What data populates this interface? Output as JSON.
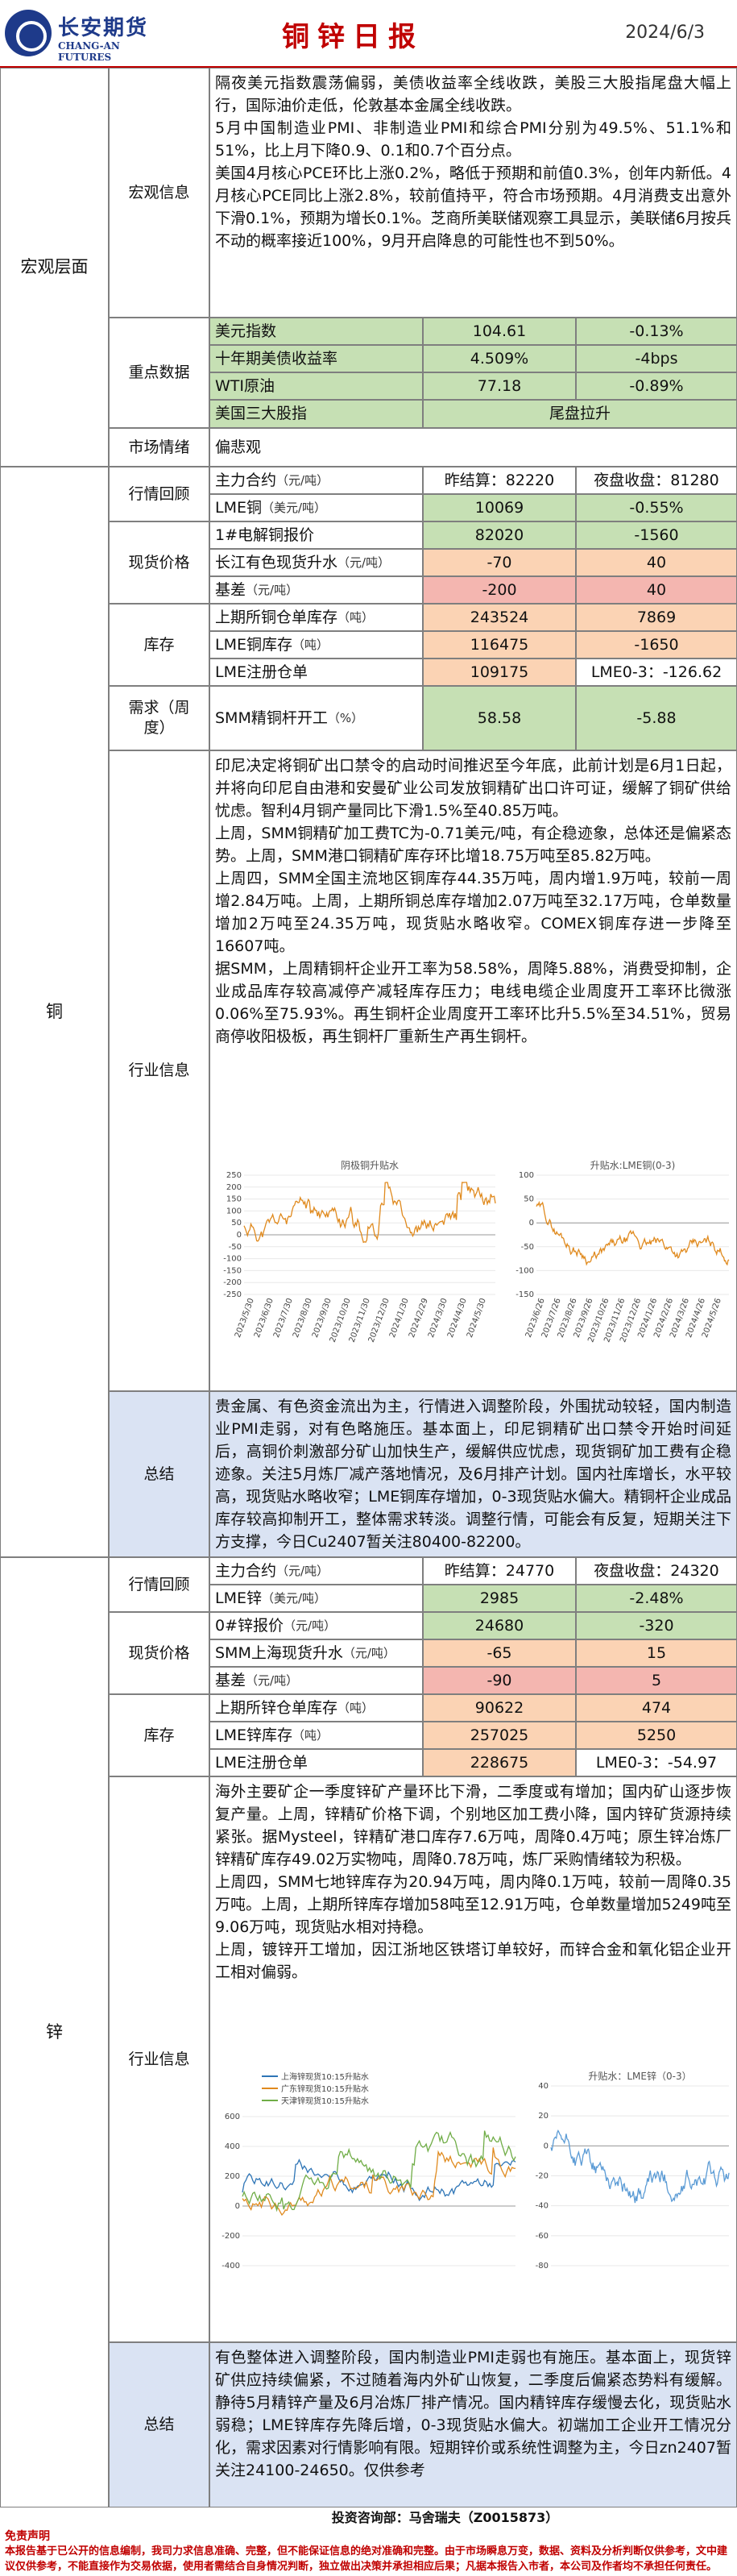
{
  "header": {
    "logo_cn": "长安期货",
    "logo_en": "CHANG-AN FUTURES",
    "title": "铜锌日报",
    "date": "2024/6/3"
  },
  "macro": {
    "section": "宏观层面",
    "info_label": "宏观信息",
    "info_text": "隔夜美元指数震荡偏弱，美债收益率全线收跌，美股三大股指尾盘大幅上行，国际油价走低，伦敦基本金属全线收跌。\n5月中国制造业PMI、非制造业PMI和综合PMI分别为49.5%、51.1%和51%，比上月下降0.9、0.1和0.7个百分点。\n美国4月核心PCE环比上涨0.2%，略低于预期和前值0.3%，创年内新低。4月核心PCE同比上涨2.8%，较前值持平，符合市场预期。4月消费支出意外下滑0.1%，预期为增长0.1%。芝商所美联储观察工具显示，美联储6月按兵不动的概率接近100%，9月开启降息的可能性也不到50%。",
    "key_label": "重点数据",
    "key_rows": [
      {
        "name": "美元指数",
        "value": "104.61",
        "change": "-0.13%"
      },
      {
        "name": "十年期美债收益率",
        "value": "4.509%",
        "change": "-4bps"
      },
      {
        "name": "WTI原油",
        "value": "77.18",
        "change": "-0.89%"
      },
      {
        "name": "美国三大股指",
        "value": "",
        "change": "尾盘拉升"
      }
    ],
    "sentiment_label": "市场情绪",
    "sentiment_value": "偏悲观"
  },
  "copper": {
    "section": "铜",
    "review_label": "行情回顾",
    "main_contract": "主力合约",
    "unit_yuan_ton": "（元/吨）",
    "unit_usd_ton": "（美元/吨）",
    "unit_ton": "（吨）",
    "unit_pct": "（%）",
    "settle": "昨结算：82220",
    "night": "夜盘收盘：81280",
    "lme_name": "LME铜",
    "lme_value": "10069",
    "lme_change": "-0.55%",
    "spot_label": "现货价格",
    "spot_rows": [
      {
        "name": "1#电解铜报价",
        "unit": "",
        "value": "82020",
        "change": "-1560"
      },
      {
        "name": "长江有色现货升水",
        "unit": "（元/吨）",
        "value": "-70",
        "change": "40"
      },
      {
        "name": "基差",
        "unit": "（元/吨）",
        "value": "-200",
        "change": "40"
      }
    ],
    "inv_label": "库存",
    "inv_rows": [
      {
        "name": "上期所铜仓单库存",
        "unit": "（吨）",
        "value": "243524",
        "change": "7869"
      },
      {
        "name": "LME铜库存",
        "unit": "（吨）",
        "value": "116475",
        "change": "-1650"
      },
      {
        "name": "LME注册仓单",
        "unit": "",
        "value": "109175",
        "change": "LME0-3：-126.62"
      }
    ],
    "demand_label": "需求（周度）",
    "demand_name": "SMM精铜杆开工",
    "demand_value": "58.58",
    "demand_change": "-5.88",
    "industry_label": "行业信息",
    "industry_text": "印尼决定将铜矿出口禁令的启动时间推迟至今年底，此前计划是6月1日起，并将向印尼自由港和安曼矿业公司发放铜精矿出口许可证，缓解了铜矿供给忧虑。智利4月铜产量同比下滑1.5%至40.85万吨。\n上周，SMM铜精矿加工费TC为-0.71美元/吨，有企稳迹象，总体还是偏紧态势。上周，SMM港口铜精矿库存环比增18.75万吨至85.82万吨。\n上周四，SMM全国主流地区铜库存44.35万吨，周内增1.9万吨，较前一周增2.84万吨。上周，上期所铜总库存增加2.07万吨至32.17万吨，仓单数量增加2万吨至24.35万吨，现货贴水略收窄。COMEX铜库存进一步降至16607吨。\n据SMM，上周精铜杆企业开工率为58.58%，周降5.88%，消费受抑制，企业成品库存较高减停产减轻库存压力；电线电缆企业周度开工率环比微涨0.06%至75.93%。再生铜杆企业周度开工率环比升5.5%至34.51%，贸易商停收阳极板，再生铜杆厂重新生产再生铜杆。",
    "summary_label": "总结",
    "summary_text": "贵金属、有色资金流出为主，行情进入调整阶段，外围扰动较轻，国内制造业PMI走弱，对有色略施压。基本面上，印尼铜精矿出口禁令开始时间延后，高铜价刺激部分矿山加快生产，缓解供应忧虑，现货铜矿加工费有企稳迹象。关注5月炼厂减产落地情况，及6月排产计划。国内社库增长，水平较高，现货贴水略收窄；LME铜库存增加，0-3现货贴水偏大。精铜杆企业成品库存较高抑制开工，整体需求转淡。调整行情，可能会有反复，短期关注下方支撑，今日Cu2407暂关注80400-82200。"
  },
  "zinc": {
    "section": "锌",
    "review_label": "行情回顾",
    "main_contract": "主力合约",
    "settle": "昨结算：24770",
    "night": "夜盘收盘：24320",
    "lme_name": "LME锌",
    "lme_value": "2985",
    "lme_change": "-2.48%",
    "spot_label": "现货价格",
    "spot_rows": [
      {
        "name": "0#锌报价",
        "unit": "（元/吨）",
        "value": "24680",
        "change": "-320"
      },
      {
        "name": "SMM上海现货升水",
        "unit": "（元/吨）",
        "value": "-65",
        "change": "15"
      },
      {
        "name": "基差",
        "unit": "（元/吨）",
        "value": "-90",
        "change": "5"
      }
    ],
    "inv_label": "库存",
    "inv_rows": [
      {
        "name": "上期所锌仓单库存",
        "unit": "（吨）",
        "value": "90622",
        "change": "474"
      },
      {
        "name": "LME锌库存",
        "unit": "（吨）",
        "value": "257025",
        "change": "5250"
      },
      {
        "name": "LME注册仓单",
        "unit": "",
        "value": "228675",
        "change": "LME0-3：-54.97"
      }
    ],
    "industry_label": "行业信息",
    "industry_text": "海外主要矿企一季度锌矿产量环比下滑，二季度或有增加；国内矿山逐步恢复产量。上周，锌精矿价格下调，个别地区加工费小降，国内锌矿货源持续紧张。据Mysteel，锌精矿港口库存7.6万吨，周降0.4万吨；原生锌冶炼厂锌精矿库存49.02万实物吨，周降0.78万吨，炼厂采购情绪较为积极。\n上周四，SMM七地锌库存为20.94万吨，周内降0.1万吨，较前一周降0.35万吨。上周，上期所锌库存增加58吨至12.91万吨，仓单数量增加5249吨至9.06万吨，现货贴水相对持稳。\n上周，镀锌开工增加，因江浙地区铁塔订单较好，而锌合金和氧化铝企业开工相对偏弱。",
    "summary_label": "总结",
    "summary_text": "有色整体进入调整阶段，国内制造业PMI走弱也有施压。基本面上，现货锌矿供应持续偏紧，不过随着海内外矿山恢复，二季度后偏紧态势料有缓解。静待5月精锌产量及6月冶炼厂排产情况。国内精锌库存缓慢去化，现货贴水弱稳；LME锌库存先降后增，0-3现货贴水偏大。初端加工企业开工情况分化，需求因素对行情影响有限。短期锌价或系统性调整为主，今日zn2407暂关注24100-24650。仅供参考"
  },
  "charts": {
    "cu_spot": {
      "title": "阴极铜升贴水",
      "x_ticks": [
        "2023/5/30",
        "2023/6/30",
        "2023/7/30",
        "2023/8/30",
        "2023/9/30",
        "2023/10/30",
        "2023/11/30",
        "2023/12/30",
        "2024/1/30",
        "2024/2/29",
        "2024/3/30",
        "2024/4/30",
        "2024/5/30"
      ],
      "y_ticks": [
        "250",
        "200",
        "150",
        "100",
        "50",
        "0",
        "-50",
        "-100",
        "-150",
        "-200",
        "-250"
      ],
      "ylim": [
        -250,
        250
      ],
      "color": "#e08a1e"
    },
    "cu_lme": {
      "title": "升贴水:LME铜(0-3)",
      "x_ticks": [
        "2023/6/26",
        "2023/7/26",
        "2023/8/26",
        "2023/9/26",
        "2023/10/26",
        "2023/11/26",
        "2023/12/26",
        "2024/1/26",
        "2024/2/26",
        "2024/3/26",
        "2024/4/26",
        "2024/5/26"
      ],
      "y_ticks": [
        "100",
        "50",
        "0",
        "-50",
        "-100",
        "-150"
      ],
      "ylim": [
        -150,
        100
      ],
      "color": "#e08a1e"
    },
    "zn_spot": {
      "legend": [
        "上海锌现货10:15升贴水",
        "广东锌现货10:15升贴水",
        "天津锌现货10:15升贴水"
      ],
      "colors": [
        "#2e75b6",
        "#e08a1e",
        "#70ad47"
      ],
      "y_ticks": [
        "600",
        "400",
        "200",
        "0",
        "-200",
        "-400"
      ],
      "ylim": [
        -400,
        600
      ]
    },
    "zn_lme": {
      "title": "升贴水：LME锌（0-3）",
      "y_ticks": [
        "40",
        "20",
        "0",
        "-20",
        "-40",
        "-60",
        "-80"
      ],
      "ylim": [
        -80,
        40
      ],
      "color": "#5b9bd5"
    }
  },
  "footer": {
    "contact": "投资咨询部：马舍瑞夫（Z0015873）",
    "disclaimer_title": "免责声明",
    "disclaimer": "本报告基于已公开的信息编制，我司力求信息准确、完整，但不能保证信息的绝对准确和完整。由于市场瞬息万变，数据、资料及分析判断仅供参考，文中建议仅供参考，不能直接作为交易依据，使用者需结合自身情况判断，独立做出决策并承担相应后果；凡据本报告入市者，本公司及作者均不承担任何责任。"
  }
}
